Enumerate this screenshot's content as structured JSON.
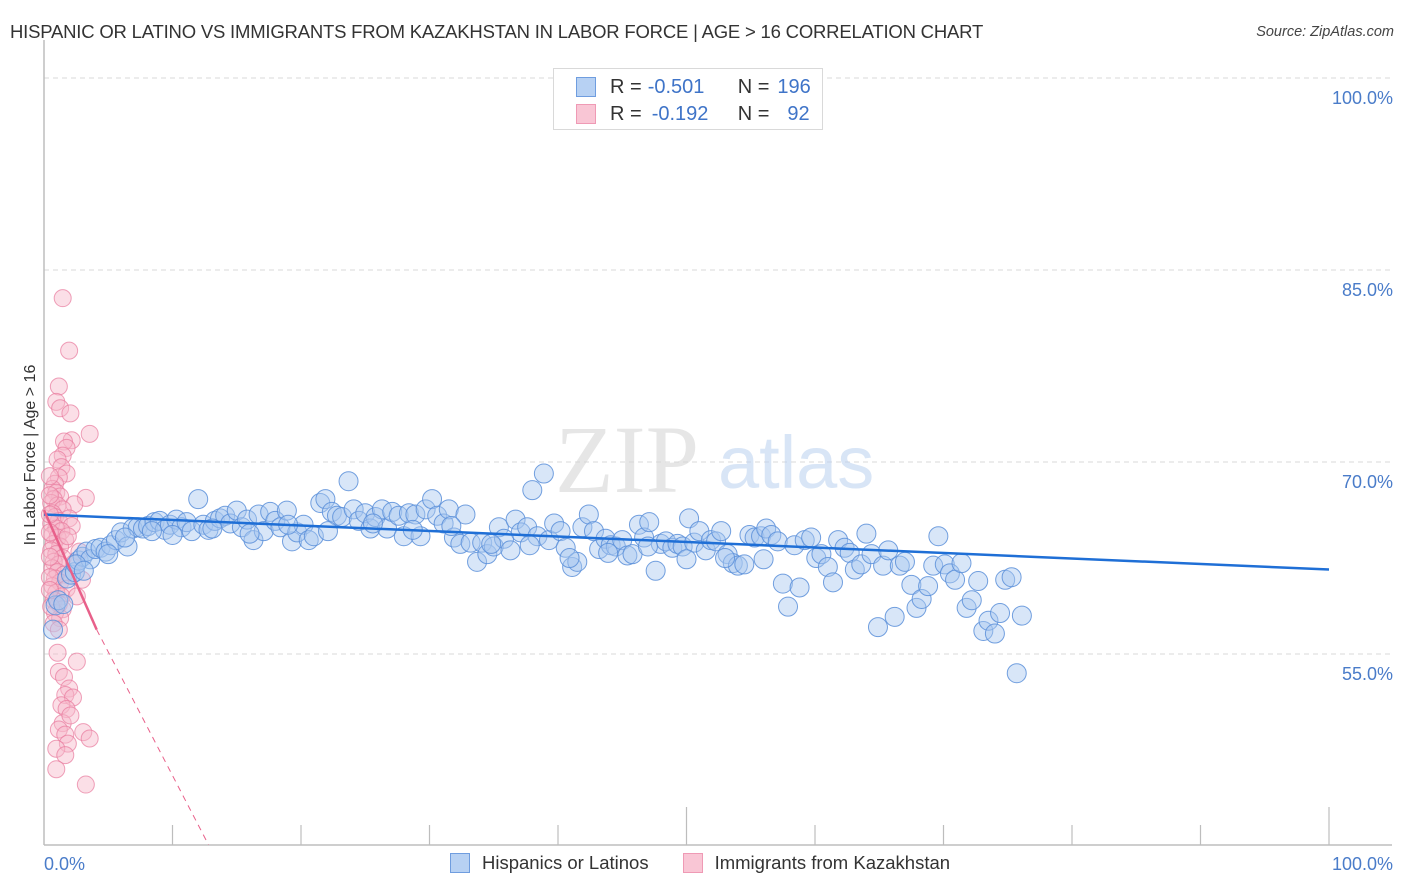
{
  "header": {
    "title": "HISPANIC OR LATINO VS IMMIGRANTS FROM KAZAKHSTAN IN LABOR FORCE | AGE > 16 CORRELATION CHART",
    "source": "Source: ZipAtlas.com"
  },
  "legend_top": {
    "rows": [
      {
        "r_label": "R = ",
        "r_value": "-0.501",
        "n_label": "N = ",
        "n_value": "196"
      },
      {
        "r_label": "R = ",
        "r_value": "-0.192",
        "n_label": "N = ",
        "n_value": "92"
      }
    ]
  },
  "legend_bottom": {
    "items": [
      {
        "label": "Hispanics or Latinos"
      },
      {
        "label": "Immigrants from Kazakhstan"
      }
    ]
  },
  "watermark": {
    "zip": "ZIP",
    "atlas": "atlas"
  },
  "colors": {
    "blue_fill": "#a9c8f0",
    "blue_stroke": "#5b8fd9",
    "blue_line": "#1f6fd6",
    "pink_fill": "#f6b7c9",
    "pink_stroke": "#e8799c",
    "pink_line": "#e8608a",
    "tick_text": "#4a7cc9",
    "grid": "#d9d9d9",
    "axis": "#bdbdbd"
  },
  "chart_data": {
    "type": "scatter",
    "title": "HISPANIC OR LATINO VS IMMIGRANTS FROM KAZAKHSTAN IN LABOR FORCE | AGE > 16 CORRELATION CHART",
    "xlabel": "",
    "ylabel": "In Labor Force | Age > 16",
    "xlim": [
      0,
      100
    ],
    "ylim": [
      40.1,
      101.5
    ],
    "x_tick_labels": [
      "0.0%",
      "100.0%"
    ],
    "y_ticks": [
      55,
      70,
      85,
      100
    ],
    "y_tick_labels": [
      "55.0%",
      "70.0%",
      "85.0%",
      "100.0%"
    ],
    "grid": "horizontal dashed",
    "legend": "top-center",
    "series": [
      {
        "name": "Hispanics or Latinos",
        "R": -0.501,
        "N": 196,
        "trend": {
          "x": [
            0,
            100
          ],
          "y": [
            65.9,
            61.6
          ]
        },
        "points": [
          [
            0.7,
            56.9
          ],
          [
            0.9,
            58.8
          ],
          [
            1.1,
            59.2
          ],
          [
            1.5,
            58.9
          ],
          [
            1.8,
            60.9
          ],
          [
            2.1,
            61.2
          ],
          [
            2.4,
            61.4
          ],
          [
            2.7,
            62.3
          ],
          [
            3.0,
            62.6
          ],
          [
            3.3,
            63.0
          ],
          [
            3.6,
            62.4
          ],
          [
            4.0,
            63.2
          ],
          [
            4.4,
            63.3
          ],
          [
            4.8,
            63.0
          ],
          [
            5.2,
            63.5
          ],
          [
            5.6,
            63.9
          ],
          [
            6.0,
            64.5
          ],
          [
            6.5,
            63.4
          ],
          [
            6.9,
            64.8
          ],
          [
            7.3,
            64.9
          ],
          [
            7.7,
            64.8
          ],
          [
            8.1,
            65.0
          ],
          [
            8.6,
            65.3
          ],
          [
            9.0,
            65.4
          ],
          [
            9.4,
            64.7
          ],
          [
            9.8,
            65.1
          ],
          [
            10.3,
            65.5
          ],
          [
            10.7,
            64.9
          ],
          [
            11.1,
            65.3
          ],
          [
            11.5,
            64.6
          ],
          [
            12.0,
            67.1
          ],
          [
            12.4,
            65.1
          ],
          [
            12.8,
            64.7
          ],
          [
            13.3,
            65.4
          ],
          [
            13.7,
            65.6
          ],
          [
            14.1,
            65.8
          ],
          [
            14.5,
            65.2
          ],
          [
            15.0,
            66.2
          ],
          [
            15.4,
            64.9
          ],
          [
            15.8,
            65.5
          ],
          [
            16.3,
            63.9
          ],
          [
            16.7,
            65.9
          ],
          [
            17.1,
            64.6
          ],
          [
            17.6,
            66.1
          ],
          [
            18.0,
            65.4
          ],
          [
            18.4,
            64.9
          ],
          [
            18.9,
            66.2
          ],
          [
            19.3,
            63.8
          ],
          [
            19.7,
            64.5
          ],
          [
            20.2,
            65.1
          ],
          [
            20.6,
            63.9
          ],
          [
            21.0,
            64.2
          ],
          [
            21.5,
            66.8
          ],
          [
            21.9,
            67.1
          ],
          [
            22.4,
            66.1
          ],
          [
            22.8,
            65.8
          ],
          [
            23.2,
            65.7
          ],
          [
            23.7,
            68.5
          ],
          [
            24.1,
            66.3
          ],
          [
            24.5,
            65.4
          ],
          [
            25.0,
            66.0
          ],
          [
            25.4,
            64.8
          ],
          [
            25.8,
            65.7
          ],
          [
            26.3,
            66.3
          ],
          [
            26.7,
            64.8
          ],
          [
            27.1,
            66.1
          ],
          [
            27.6,
            65.8
          ],
          [
            28.0,
            64.2
          ],
          [
            28.4,
            66.0
          ],
          [
            28.9,
            65.9
          ],
          [
            29.3,
            64.2
          ],
          [
            29.7,
            66.3
          ],
          [
            30.2,
            67.1
          ],
          [
            30.6,
            65.8
          ],
          [
            31.1,
            65.2
          ],
          [
            31.5,
            66.3
          ],
          [
            31.9,
            64.1
          ],
          [
            32.4,
            63.6
          ],
          [
            32.8,
            65.9
          ],
          [
            33.2,
            63.7
          ],
          [
            33.7,
            62.2
          ],
          [
            34.1,
            63.7
          ],
          [
            34.5,
            62.8
          ],
          [
            35.0,
            63.4
          ],
          [
            35.4,
            64.9
          ],
          [
            35.8,
            64.0
          ],
          [
            36.3,
            63.1
          ],
          [
            36.7,
            65.5
          ],
          [
            37.1,
            64.5
          ],
          [
            37.6,
            64.9
          ],
          [
            38.0,
            67.8
          ],
          [
            38.4,
            64.2
          ],
          [
            38.9,
            69.1
          ],
          [
            39.3,
            63.9
          ],
          [
            39.7,
            65.2
          ],
          [
            40.2,
            64.6
          ],
          [
            40.6,
            63.3
          ],
          [
            41.1,
            61.8
          ],
          [
            41.5,
            62.2
          ],
          [
            41.9,
            64.9
          ],
          [
            42.4,
            65.9
          ],
          [
            42.8,
            64.6
          ],
          [
            43.2,
            63.2
          ],
          [
            43.7,
            64.0
          ],
          [
            44.1,
            63.5
          ],
          [
            44.5,
            63.4
          ],
          [
            45.0,
            63.9
          ],
          [
            45.4,
            62.7
          ],
          [
            45.8,
            62.8
          ],
          [
            46.3,
            65.1
          ],
          [
            46.7,
            64.1
          ],
          [
            47.1,
            65.3
          ],
          [
            47.6,
            61.5
          ],
          [
            48.0,
            63.6
          ],
          [
            48.4,
            63.8
          ],
          [
            48.9,
            63.3
          ],
          [
            49.3,
            63.6
          ],
          [
            49.7,
            63.4
          ],
          [
            50.2,
            65.6
          ],
          [
            50.6,
            63.7
          ],
          [
            51.0,
            64.6
          ],
          [
            51.5,
            63.1
          ],
          [
            51.9,
            63.9
          ],
          [
            52.3,
            63.8
          ],
          [
            52.7,
            64.6
          ],
          [
            53.2,
            62.8
          ],
          [
            53.6,
            62.1
          ],
          [
            54.0,
            61.9
          ],
          [
            54.5,
            62.0
          ],
          [
            54.9,
            64.3
          ],
          [
            55.3,
            64.1
          ],
          [
            55.8,
            64.2
          ],
          [
            56.2,
            64.8
          ],
          [
            56.6,
            64.3
          ],
          [
            57.1,
            63.8
          ],
          [
            57.5,
            60.5
          ],
          [
            57.9,
            58.7
          ],
          [
            58.4,
            63.5
          ],
          [
            58.8,
            60.2
          ],
          [
            59.2,
            63.9
          ],
          [
            59.7,
            64.1
          ],
          [
            60.1,
            62.5
          ],
          [
            60.5,
            62.8
          ],
          [
            61.0,
            61.8
          ],
          [
            61.4,
            60.6
          ],
          [
            61.8,
            63.9
          ],
          [
            62.3,
            63.3
          ],
          [
            62.7,
            62.9
          ],
          [
            63.1,
            61.6
          ],
          [
            63.6,
            62.0
          ],
          [
            64.0,
            64.4
          ],
          [
            64.4,
            62.8
          ],
          [
            64.9,
            57.1
          ],
          [
            65.3,
            61.9
          ],
          [
            65.7,
            63.1
          ],
          [
            66.2,
            57.9
          ],
          [
            66.6,
            61.9
          ],
          [
            67.0,
            62.2
          ],
          [
            67.5,
            60.4
          ],
          [
            67.9,
            58.6
          ],
          [
            68.3,
            59.3
          ],
          [
            68.8,
            60.3
          ],
          [
            69.2,
            61.9
          ],
          [
            69.6,
            64.2
          ],
          [
            70.1,
            62.0
          ],
          [
            70.5,
            61.3
          ],
          [
            70.9,
            60.8
          ],
          [
            71.4,
            62.1
          ],
          [
            71.8,
            58.6
          ],
          [
            72.2,
            59.2
          ],
          [
            72.7,
            60.7
          ],
          [
            73.1,
            56.8
          ],
          [
            73.5,
            57.6
          ],
          [
            74.0,
            56.6
          ],
          [
            74.4,
            58.2
          ],
          [
            74.8,
            60.8
          ],
          [
            75.3,
            61.0
          ],
          [
            75.7,
            53.5
          ],
          [
            76.1,
            58.0
          ],
          [
            2.5,
            62.0
          ],
          [
            3.1,
            61.5
          ],
          [
            5.0,
            62.8
          ],
          [
            6.3,
            64.1
          ],
          [
            8.4,
            64.6
          ],
          [
            10.0,
            64.3
          ],
          [
            13.1,
            64.8
          ],
          [
            16.0,
            64.4
          ],
          [
            19.0,
            65.1
          ],
          [
            22.1,
            64.6
          ],
          [
            25.6,
            65.2
          ],
          [
            28.7,
            64.7
          ],
          [
            31.7,
            65.0
          ],
          [
            34.8,
            63.6
          ],
          [
            37.8,
            63.5
          ],
          [
            40.9,
            62.5
          ],
          [
            43.9,
            62.9
          ],
          [
            47.0,
            63.4
          ],
          [
            50.0,
            62.4
          ],
          [
            53.0,
            62.5
          ],
          [
            56.0,
            62.4
          ]
        ]
      },
      {
        "name": "Immigrants from Kazakhstan",
        "R": -0.192,
        "N": 92,
        "trend": {
          "x": [
            0,
            4.1
          ],
          "y": [
            66.25,
            56.9
          ],
          "dashed_extension": {
            "x": [
              4.1,
              12.8
            ],
            "y": [
              56.9,
              40.1
            ]
          }
        },
        "points": [
          [
            1.3,
            82.8
          ],
          [
            1.8,
            78.7
          ],
          [
            1.0,
            75.9
          ],
          [
            0.8,
            74.7
          ],
          [
            1.1,
            74.2
          ],
          [
            1.9,
            73.8
          ],
          [
            3.4,
            72.2
          ],
          [
            2.0,
            71.7
          ],
          [
            1.4,
            71.6
          ],
          [
            1.6,
            71.1
          ],
          [
            1.3,
            70.5
          ],
          [
            0.9,
            70.2
          ],
          [
            1.2,
            69.6
          ],
          [
            1.6,
            69.1
          ],
          [
            1.0,
            68.8
          ],
          [
            0.7,
            68.3
          ],
          [
            0.5,
            67.9
          ],
          [
            0.8,
            67.6
          ],
          [
            1.1,
            67.3
          ],
          [
            0.6,
            67.1
          ],
          [
            3.1,
            67.2
          ],
          [
            0.4,
            66.8
          ],
          [
            0.9,
            66.6
          ],
          [
            2.2,
            66.7
          ],
          [
            1.3,
            66.3
          ],
          [
            0.5,
            66.0
          ],
          [
            0.7,
            65.7
          ],
          [
            1.0,
            65.4
          ],
          [
            1.8,
            65.6
          ],
          [
            0.4,
            65.2
          ],
          [
            2.0,
            65.0
          ],
          [
            0.8,
            64.8
          ],
          [
            1.2,
            64.6
          ],
          [
            0.5,
            64.3
          ],
          [
            0.9,
            64.1
          ],
          [
            1.5,
            63.9
          ],
          [
            0.6,
            63.6
          ],
          [
            1.1,
            63.4
          ],
          [
            2.6,
            63.0
          ],
          [
            0.4,
            63.1
          ],
          [
            0.8,
            62.8
          ],
          [
            1.3,
            62.5
          ],
          [
            0.6,
            62.2
          ],
          [
            1.0,
            62.0
          ],
          [
            2.2,
            62.1
          ],
          [
            0.5,
            61.7
          ],
          [
            0.9,
            61.4
          ],
          [
            1.4,
            61.2
          ],
          [
            0.7,
            60.9
          ],
          [
            1.1,
            60.6
          ],
          [
            0.5,
            60.3
          ],
          [
            1.6,
            60.1
          ],
          [
            0.8,
            59.8
          ],
          [
            1.2,
            59.5
          ],
          [
            0.6,
            59.2
          ],
          [
            1.0,
            58.9
          ],
          [
            1.3,
            58.5
          ],
          [
            0.7,
            58.2
          ],
          [
            1.1,
            57.8
          ],
          [
            0.6,
            57.4
          ],
          [
            1.0,
            56.9
          ],
          [
            0.9,
            55.1
          ],
          [
            1.0,
            53.6
          ],
          [
            1.4,
            53.2
          ],
          [
            1.8,
            52.3
          ],
          [
            1.5,
            51.8
          ],
          [
            2.1,
            51.6
          ],
          [
            1.2,
            51.0
          ],
          [
            1.6,
            50.7
          ],
          [
            1.3,
            49.6
          ],
          [
            1.0,
            49.1
          ],
          [
            1.5,
            48.7
          ],
          [
            2.9,
            48.9
          ],
          [
            3.4,
            48.4
          ],
          [
            1.7,
            48.0
          ],
          [
            0.8,
            47.6
          ],
          [
            1.5,
            47.1
          ],
          [
            0.8,
            46.0
          ],
          [
            3.1,
            44.8
          ],
          [
            1.9,
            50.2
          ],
          [
            2.4,
            54.4
          ],
          [
            0.4,
            58.7
          ],
          [
            0.3,
            61.0
          ],
          [
            0.3,
            62.6
          ],
          [
            0.3,
            64.5
          ],
          [
            0.3,
            65.9
          ],
          [
            0.3,
            67.4
          ],
          [
            0.3,
            68.9
          ],
          [
            0.3,
            60.0
          ],
          [
            2.8,
            60.8
          ],
          [
            2.4,
            59.5
          ],
          [
            1.7,
            64.2
          ]
        ]
      }
    ]
  }
}
